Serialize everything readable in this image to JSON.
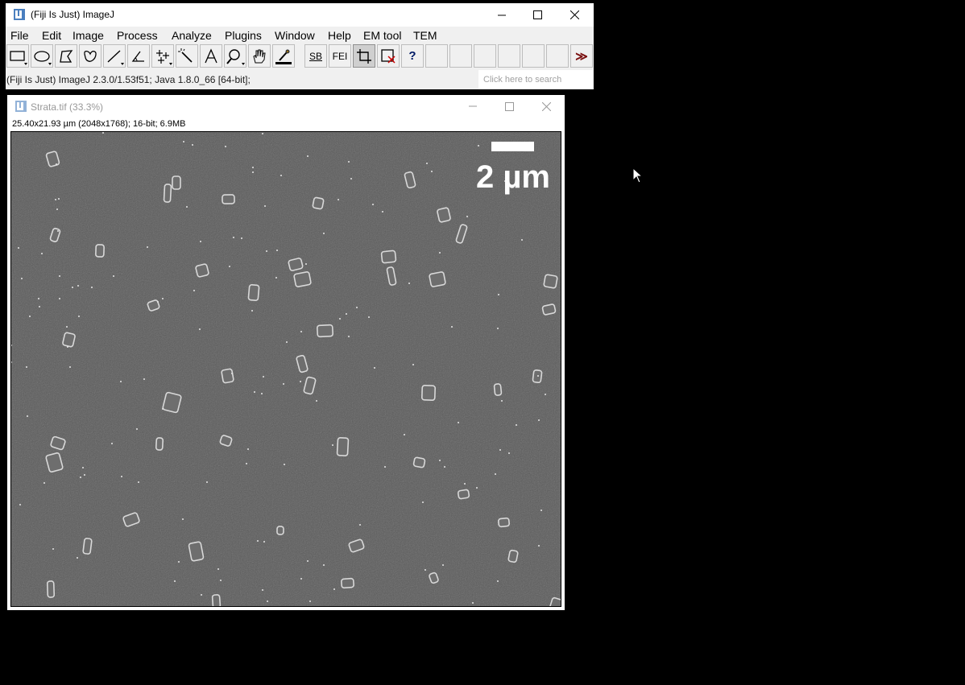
{
  "main_window": {
    "title": "(Fiji Is Just) ImageJ",
    "menu": [
      "File",
      "Edit",
      "Image",
      "Process",
      "Analyze",
      "Plugins",
      "Window",
      "Help",
      "EM tool",
      "TEM"
    ],
    "toolbar": {
      "tools": [
        {
          "name": "rectangle-tool-icon"
        },
        {
          "name": "oval-tool-icon"
        },
        {
          "name": "polygon-tool-icon"
        },
        {
          "name": "freehand-tool-icon"
        },
        {
          "name": "line-tool-icon"
        },
        {
          "name": "angle-tool-icon"
        },
        {
          "name": "multipoint-tool-icon"
        },
        {
          "name": "wand-tool-icon"
        },
        {
          "name": "text-tool-icon"
        },
        {
          "name": "magnifier-tool-icon"
        },
        {
          "name": "hand-tool-icon"
        },
        {
          "name": "dropper-tool-icon"
        }
      ],
      "sb_label": "SB",
      "fei_label": "FEI",
      "help_label": "?",
      "more_label": "≫"
    },
    "status_text": "(Fiji Is Just) ImageJ 2.3.0/1.53f51; Java 1.8.0_66 [64-bit];",
    "search_placeholder": "Click here to search"
  },
  "image_window": {
    "title": "Strata.tif (33.3%)",
    "info": "25.40x21.93 µm (2048x1768); 16-bit; 6.9MB",
    "scale_bar_label": "2 µm"
  },
  "colors": {
    "sem_background": "#5b5b5b",
    "particle": "#d8d8d8"
  }
}
